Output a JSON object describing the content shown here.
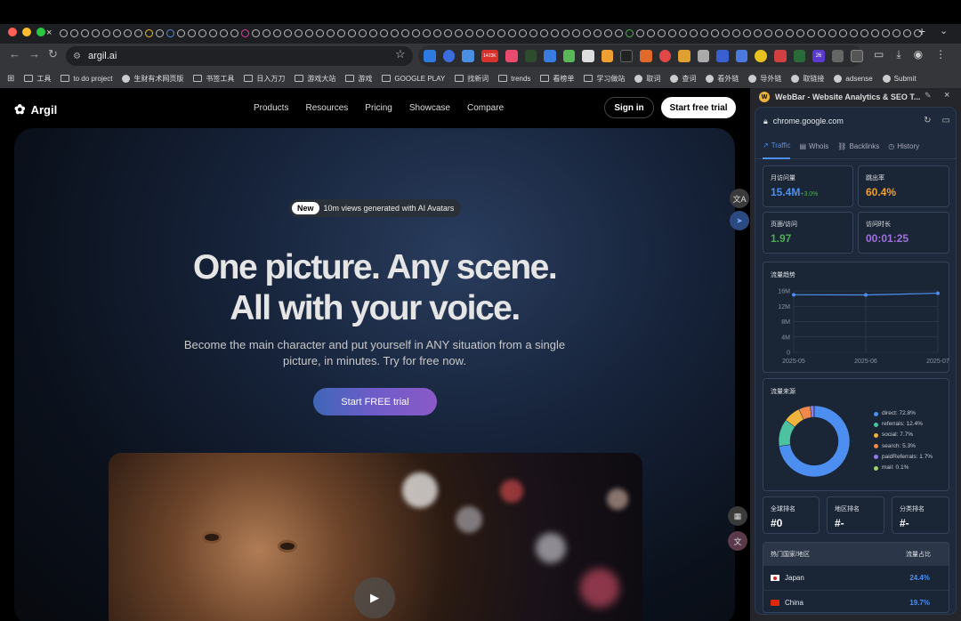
{
  "browser": {
    "tab_close": "×",
    "tab_add": "+",
    "tab_more": "⌄",
    "url": "argil.ai",
    "bookmarks": [
      {
        "type": "folder",
        "label": "工具"
      },
      {
        "type": "folder",
        "label": "to do project"
      },
      {
        "type": "globe",
        "label": "生财有术网页版"
      },
      {
        "type": "folder",
        "label": "书签工具"
      },
      {
        "type": "folder",
        "label": "日入万刀"
      },
      {
        "type": "folder",
        "label": "游戏大站"
      },
      {
        "type": "folder",
        "label": "游戏"
      },
      {
        "type": "folder",
        "label": "GOOGLE PLAY"
      },
      {
        "type": "folder",
        "label": "找新词"
      },
      {
        "type": "folder",
        "label": "trends"
      },
      {
        "type": "folder",
        "label": "看榜单"
      },
      {
        "type": "folder",
        "label": "学习做站"
      },
      {
        "type": "globe",
        "label": "取词"
      },
      {
        "type": "globe",
        "label": "查词"
      },
      {
        "type": "globe",
        "label": "看外链"
      },
      {
        "type": "globe",
        "label": "导外链"
      },
      {
        "type": "globe",
        "label": "取链接"
      },
      {
        "type": "globe",
        "label": "adsense"
      },
      {
        "type": "globe",
        "label": "Submit"
      }
    ],
    "ext_badge_1": "1423K",
    "ext_badge_2": "26"
  },
  "site": {
    "brand": "Argil",
    "nav": [
      "Products",
      "Resources",
      "Pricing",
      "Showcase",
      "Compare"
    ],
    "sign_in": "Sign in",
    "start_trial": "Start free trial",
    "pill_new": "New",
    "pill_text": "10m views generated with AI Avatars",
    "headline_1": "One picture. Any scene.",
    "headline_2": "All with your voice.",
    "subtitle": "Become the main character and put yourself in ANY situation from a single picture, in minutes. Try for free now.",
    "cta": "Start FREE trial"
  },
  "webbar": {
    "title": "WebBar - Website Analytics & SEO T...",
    "domain": "chrome.google.com",
    "tabs": [
      "Traffic",
      "Whois",
      "Backlinks",
      "History"
    ],
    "stats": [
      {
        "label": "月访问量",
        "value": "15.4M",
        "delta": "+3.0%",
        "color": "#4d8ff0"
      },
      {
        "label": "跳出率",
        "value": "60.4%",
        "color": "#f0a030"
      },
      {
        "label": "页面/访问",
        "value": "1.97",
        "color": "#4caf50"
      },
      {
        "label": "访问时长",
        "value": "00:01:25",
        "color": "#a070e0"
      }
    ],
    "trend_title": "流量趋势",
    "sources_title": "流量来源",
    "ranks": [
      {
        "label": "全球排名",
        "value": "#0"
      },
      {
        "label": "地区排名",
        "value": "#-"
      },
      {
        "label": "分类排名",
        "value": "#-"
      }
    ],
    "countries_header": "热门国家/地区",
    "countries_share_header": "流量占比",
    "countries": [
      {
        "name": "Japan",
        "share": "24.4%"
      },
      {
        "name": "China",
        "share": "19.7%"
      }
    ]
  },
  "chart_data": [
    {
      "type": "line",
      "title": "流量趋势",
      "x": [
        "2025-05",
        "2025-06",
        "2025-07"
      ],
      "values": [
        15.0,
        14.95,
        15.4
      ],
      "unit": "M",
      "ylim": [
        0,
        16
      ],
      "yticks": [
        "0",
        "4M",
        "8M",
        "12M",
        "16M"
      ],
      "grid": true
    },
    {
      "type": "pie",
      "title": "流量来源",
      "slices": [
        {
          "label": "direct",
          "value": 72.8,
          "text": "direct: 72.8%",
          "color": "#4d8ff0"
        },
        {
          "label": "referrals",
          "value": 12.4,
          "text": "referrals: 12.4%",
          "color": "#4cc2a0"
        },
        {
          "label": "social",
          "value": 7.7,
          "text": "social: 7.7%",
          "color": "#f0b43c"
        },
        {
          "label": "search",
          "value": 5.3,
          "text": "search: 5.3%",
          "color": "#f08a4c"
        },
        {
          "label": "paidReferrals",
          "value": 1.7,
          "text": "paidReferrals: 1.7%",
          "color": "#8c7ee8"
        },
        {
          "label": "mail",
          "value": 0.1,
          "text": "mail: 0.1%",
          "color": "#9ed26c"
        }
      ]
    }
  ]
}
